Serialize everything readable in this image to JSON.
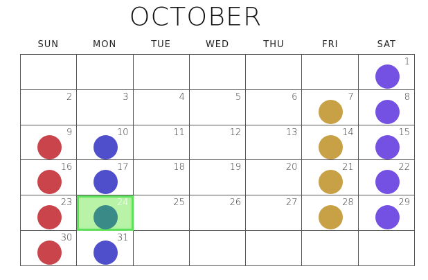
{
  "month": "OCTOBER",
  "weekdays": [
    "SUN",
    "MON",
    "TUE",
    "WED",
    "THU",
    "FRI",
    "SAT"
  ],
  "colors": {
    "sun": "#c9454b",
    "mon": "#4f4fcb",
    "fri": "#c8a045",
    "sat": "#7451e3",
    "selected_dot": "#3a8a87"
  },
  "weeks": [
    [
      "",
      "",
      "",
      "",
      "",
      "",
      "1"
    ],
    [
      "2",
      "3",
      "4",
      "5",
      "6",
      "7",
      "8"
    ],
    [
      "9",
      "10",
      "11",
      "12",
      "13",
      "14",
      "15"
    ],
    [
      "16",
      "17",
      "18",
      "19",
      "20",
      "21",
      "22"
    ],
    [
      "23",
      "24",
      "25",
      "26",
      "27",
      "28",
      "29"
    ],
    [
      "30",
      "31",
      "",
      "",
      "",
      "",
      ""
    ]
  ],
  "selected_day": "24"
}
